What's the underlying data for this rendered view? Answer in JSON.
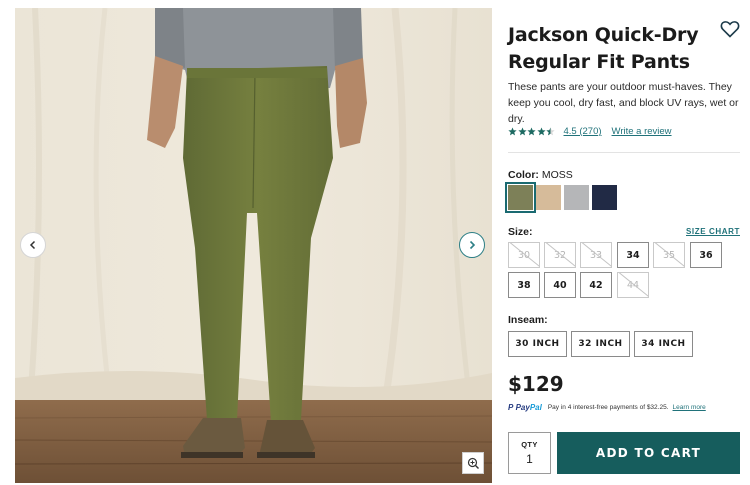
{
  "product": {
    "title_line1": "Jackson Quick-Dry",
    "title_line2": "Regular Fit Pants",
    "description": "These pants are your outdoor must-haves. They keep you cool, dry fast, and block UV rays, wet or dry.",
    "rating_value": 4.5,
    "rating_text": "4.5 (270)",
    "review_link": "Write a review",
    "icons": {
      "wishlist": "heart-outline-icon",
      "prev": "chevron-left-icon",
      "next": "chevron-right-icon",
      "zoom": "zoom-in-icon",
      "star": "star-icon"
    }
  },
  "color": {
    "label": "Color:",
    "selected": "MOSS",
    "swatches": [
      {
        "name": "Moss",
        "hex": "#7d8058",
        "selected": true
      },
      {
        "name": "Khaki",
        "hex": "#d6bb9a",
        "selected": false
      },
      {
        "name": "Gray",
        "hex": "#b5b6b8",
        "selected": false
      },
      {
        "name": "Navy",
        "hex": "#212a45",
        "selected": false
      }
    ]
  },
  "size": {
    "label": "Size:",
    "chart_link": "SIZE CHART",
    "options": [
      {
        "label": "30",
        "available": false
      },
      {
        "label": "32",
        "available": false
      },
      {
        "label": "33",
        "available": false
      },
      {
        "label": "34",
        "available": true
      },
      {
        "label": "35",
        "available": false
      },
      {
        "label": "36",
        "available": true
      },
      {
        "label": "38",
        "available": true
      },
      {
        "label": "40",
        "available": true
      },
      {
        "label": "42",
        "available": true
      },
      {
        "label": "44",
        "available": false
      }
    ]
  },
  "inseam": {
    "label": "Inseam:",
    "options": [
      "30 INCH",
      "32 INCH",
      "34 INCH"
    ]
  },
  "price": "$129",
  "paypal": {
    "logo_p": "P",
    "logo_pay": "Pay",
    "logo_pal": "Pal",
    "text": "Pay in 4 interest-free payments of $32.25.",
    "link": "Learn more"
  },
  "qty": {
    "label": "QTY",
    "value": "1"
  },
  "add_to_cart": "ADD TO CART",
  "colors": {
    "accent": "#165d5d",
    "link": "#20727a",
    "pants": "#6f7a43"
  }
}
